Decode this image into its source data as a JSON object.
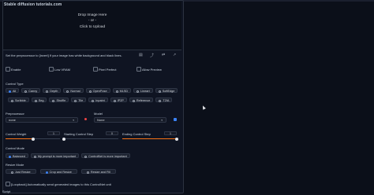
{
  "watermark": "Stable diffusion tutorials.com",
  "drop": {
    "line1": "Drop Image Here",
    "line2": "- or -",
    "line3": "Click to Upload"
  },
  "toolbar_icons": [
    "new-canvas-icon",
    "upload-icon",
    "swap-icon",
    "send-icon"
  ],
  "hint": "Set the preprocessor to [invert] If your image has white background and black lines.",
  "options": [
    "Enable",
    "Low VRAM",
    "Pixel Perfect",
    "Allow Preview"
  ],
  "control_type": {
    "label": "Control Type",
    "row1": [
      "All",
      "Canny",
      "Depth",
      "Normal",
      "OpenPose",
      "MLSD",
      "Lineart",
      "SoftEdge"
    ],
    "row2": [
      "Scribble",
      "Seg",
      "Shuffle",
      "Tile",
      "Inpaint",
      "IP2P",
      "Reference",
      "T2IA"
    ],
    "selected": "All"
  },
  "preprocessor": {
    "label": "Preprocessor",
    "value": "none"
  },
  "model": {
    "label": "Model",
    "value": "None"
  },
  "control_weight": {
    "label": "Control Weight",
    "value": "1",
    "fraction": 0.5
  },
  "starting_step": {
    "label": "Starting Control Step",
    "value": "0",
    "fraction": 0.0
  },
  "ending_step": {
    "label": "Ending Control Step",
    "value": "1",
    "fraction": 1.0
  },
  "control_mode": {
    "label": "Control Mode",
    "options": [
      "Balanced",
      "My prompt is more important",
      "ControlNet is more important"
    ],
    "selected": "Balanced"
  },
  "resize_mode": {
    "label": "Resize Mode",
    "options": [
      "Just Resize",
      "Crop and Resize",
      "Resize and Fill"
    ],
    "selected": "Crop and Resize"
  },
  "loopback": "[Loopback] Automatically send generated images to this ControlNet unit",
  "script_label": "Script",
  "colors": {
    "accent": "#f97316",
    "selected": "#3b82f6",
    "bg": "#0b0f19"
  }
}
